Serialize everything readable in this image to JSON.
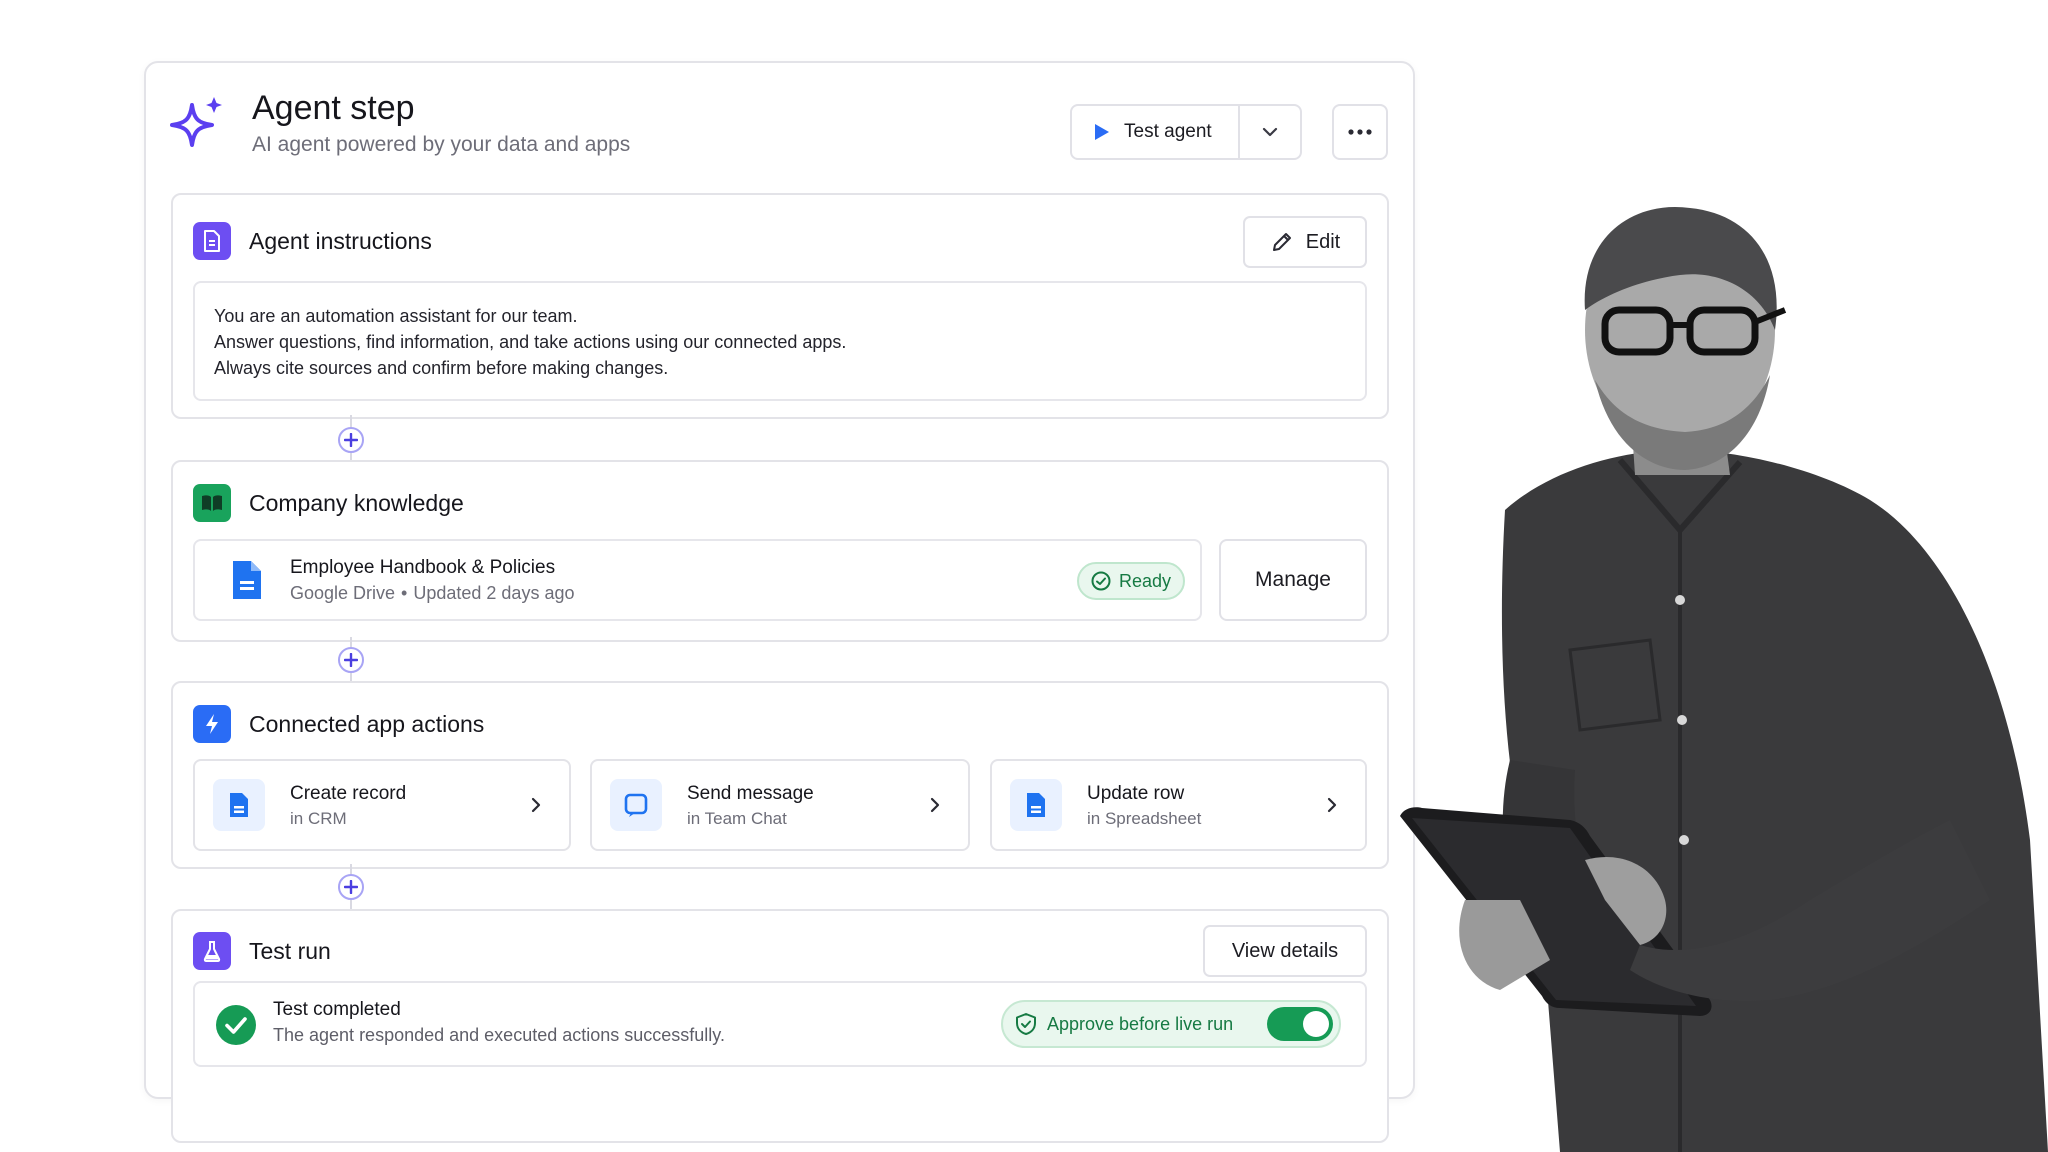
{
  "header": {
    "title": "Agent step",
    "subtitle": "AI agent powered by your data and apps",
    "test_button": "Test agent"
  },
  "instructions": {
    "title": "Agent instructions",
    "edit_label": "Edit",
    "lines": [
      "You are an automation assistant for our team.",
      "Answer questions, find information, and take actions using our connected apps.",
      "Always cite sources and confirm before making changes."
    ]
  },
  "knowledge": {
    "title": "Company knowledge",
    "source": {
      "name": "Employee Handbook & Policies",
      "provider": "Google Drive",
      "updated": "Updated 2 days ago",
      "status": "Ready"
    },
    "manage_label": "Manage"
  },
  "actions": {
    "title": "Connected app actions",
    "items": [
      {
        "name": "Create record",
        "sub": "in CRM"
      },
      {
        "name": "Send message",
        "sub": "in Team Chat"
      },
      {
        "name": "Update row",
        "sub": "in Spreadsheet"
      }
    ]
  },
  "test_run": {
    "title": "Test run",
    "details_label": "View details",
    "result_title": "Test completed",
    "result_desc": "The agent responded and executed actions successfully.",
    "approve_label": "Approve before live run",
    "approve_on": true
  },
  "colors": {
    "accent_purple": "#6d4ef2",
    "knowledge_green": "#19a35c",
    "actions_blue": "#2a6cf5",
    "success_green": "#169b55"
  }
}
